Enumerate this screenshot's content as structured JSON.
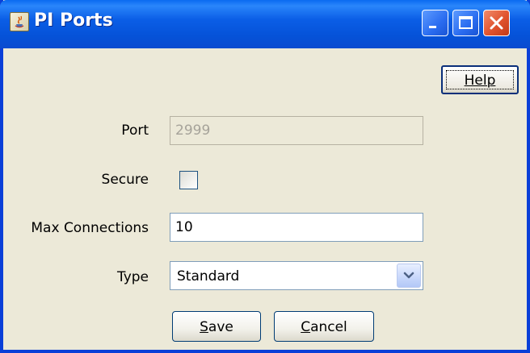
{
  "window": {
    "title": "PI Ports"
  },
  "titlebar_buttons": {
    "minimize": "minimize-icon",
    "maximize": "maximize-icon",
    "close": "close-icon"
  },
  "help_button": {
    "label": "Help"
  },
  "form": {
    "port": {
      "label": "Port",
      "value": "2999",
      "enabled": false
    },
    "secure": {
      "label": "Secure",
      "checked": false
    },
    "max_connections": {
      "label": "Max Connections",
      "value": "10"
    },
    "type": {
      "label": "Type",
      "selected": "Standard"
    }
  },
  "buttons": {
    "save": {
      "mnemonic": "S",
      "rest": "ave"
    },
    "cancel": {
      "mnemonic": "C",
      "rest": "ancel"
    }
  },
  "colors": {
    "titlebar": "#0a5ee6",
    "window_bg": "#ece9d8",
    "close_button": "#e0532e"
  }
}
